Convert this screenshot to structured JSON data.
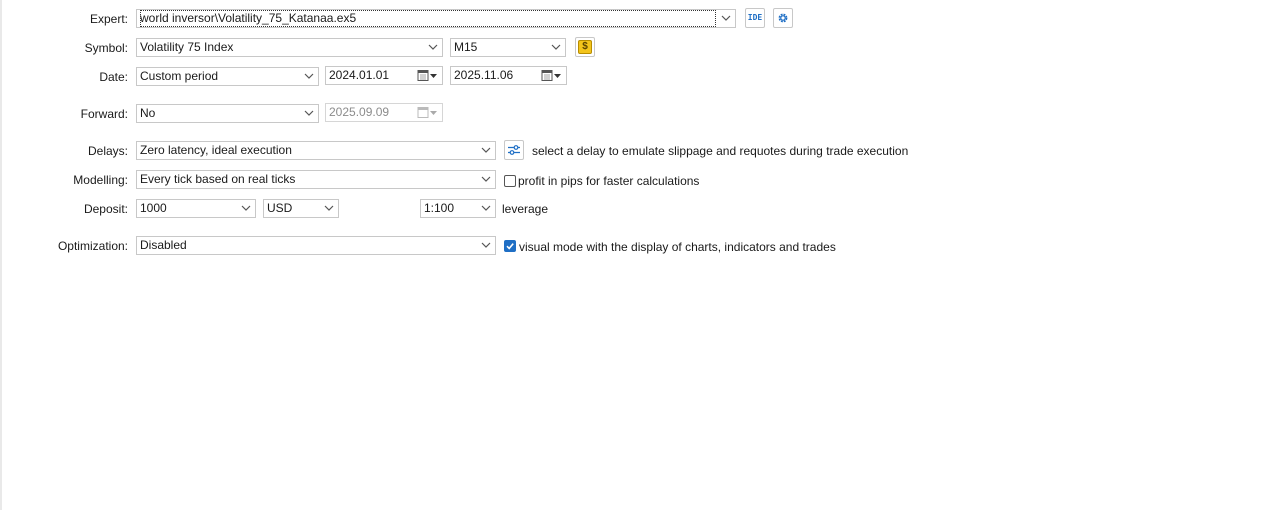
{
  "labels": {
    "expert": "Expert:",
    "symbol": "Symbol:",
    "date": "Date:",
    "forward": "Forward:",
    "delays": "Delays:",
    "modelling": "Modelling:",
    "deposit": "Deposit:",
    "optimization": "Optimization:"
  },
  "expert": {
    "value": "world inversor\\Volatility_75_Katanaa.ex5",
    "ide_label": "IDE"
  },
  "symbol": {
    "value": "Volatility 75 Index",
    "timeframe": "M15"
  },
  "date": {
    "period": "Custom period",
    "from": "2024.01.01",
    "to": "2025.11.06"
  },
  "forward": {
    "value": "No",
    "date": "2025.09.09"
  },
  "delays": {
    "value": "Zero latency, ideal execution",
    "hint": "select a delay to emulate slippage and requotes during trade execution"
  },
  "modelling": {
    "value": "Every tick based on real ticks",
    "pips_label": "profit in pips for faster calculations",
    "pips_checked": false
  },
  "deposit": {
    "amount": "1000",
    "currency": "USD",
    "leverage": "1:100",
    "leverage_label": "leverage"
  },
  "optimization": {
    "value": "Disabled",
    "visual_label": "visual mode with the display of charts, indicators and trades",
    "visual_checked": true
  },
  "colors": {
    "accent": "#1f6fc5",
    "symbol_icon_bg": "#f3c41b",
    "border": "#c8c8c8"
  }
}
